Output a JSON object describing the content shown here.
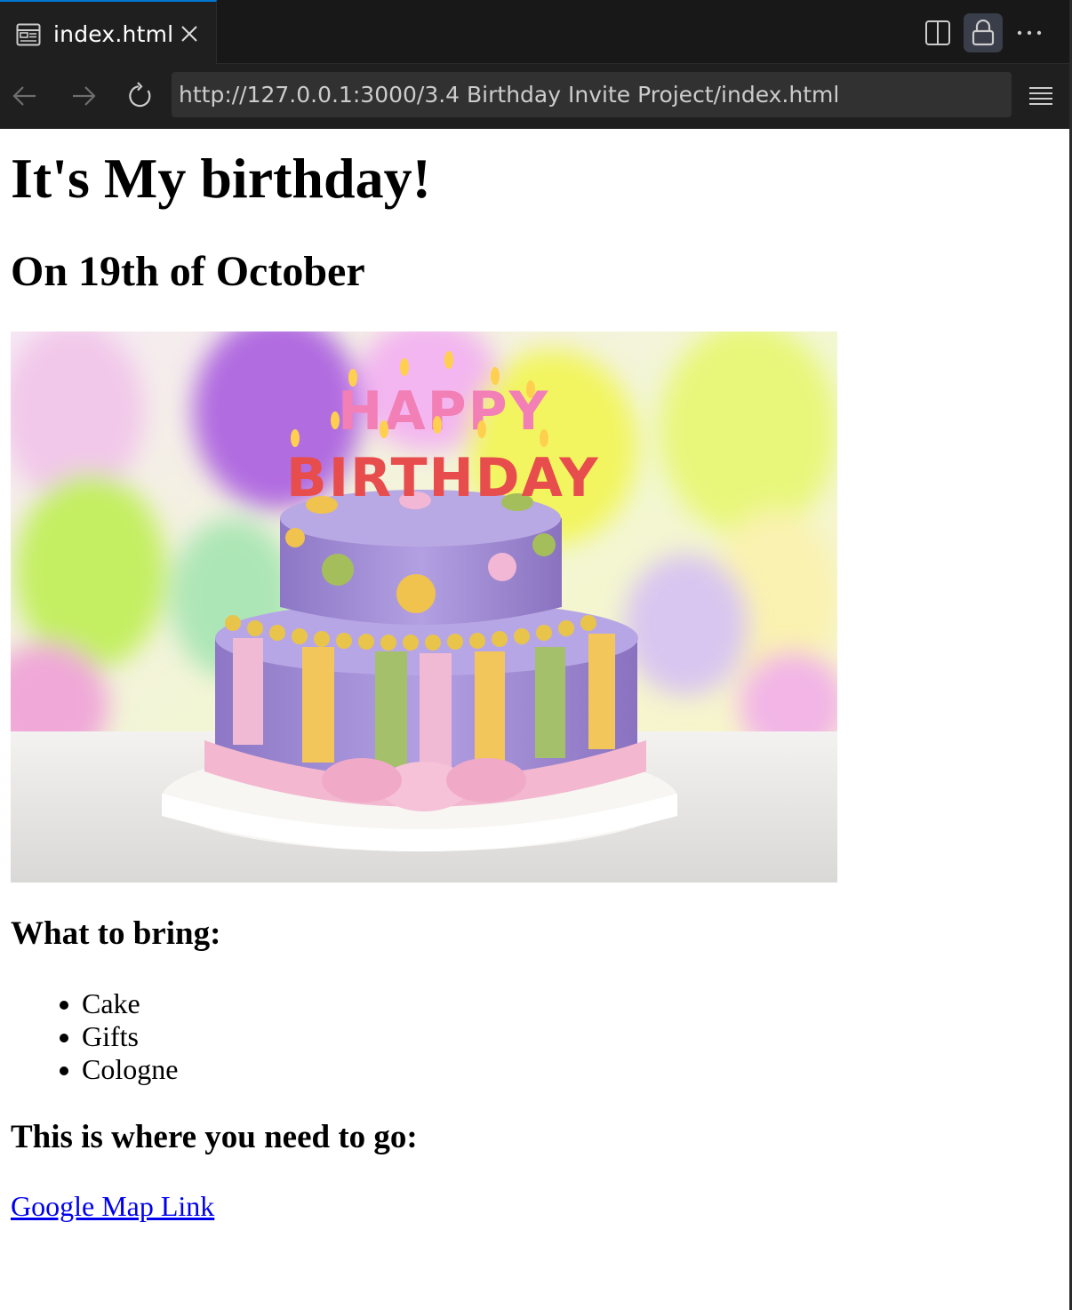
{
  "tab": {
    "title": "index.html"
  },
  "address_bar": {
    "url": "http://127.0.0.1:3000/3.4 Birthday Invite Project/index.html"
  },
  "page": {
    "heading": "It's My birthday!",
    "subheading": "On 19th of October",
    "bring_heading": "What to bring:",
    "bring_items": [
      "Cake",
      "Gifts",
      "Cologne"
    ],
    "where_heading": "This is where you need to go:",
    "map_link_text": "Google Map Link"
  },
  "cake_image": {
    "topper_line1": "HAPPY",
    "topper_line2": "BIRTHDAY"
  },
  "icons": {
    "tab": "preview-icon",
    "close": "close-icon",
    "split": "split-editor-icon",
    "lock": "lock-icon",
    "more": "more-icon",
    "back": "back-arrow-icon",
    "forward": "forward-arrow-icon",
    "reload": "reload-icon",
    "menu": "menu-icon"
  },
  "colors": {
    "accent": "#0078d4",
    "link": "#0000ee",
    "chrome_bg": "#1f1f1f"
  }
}
